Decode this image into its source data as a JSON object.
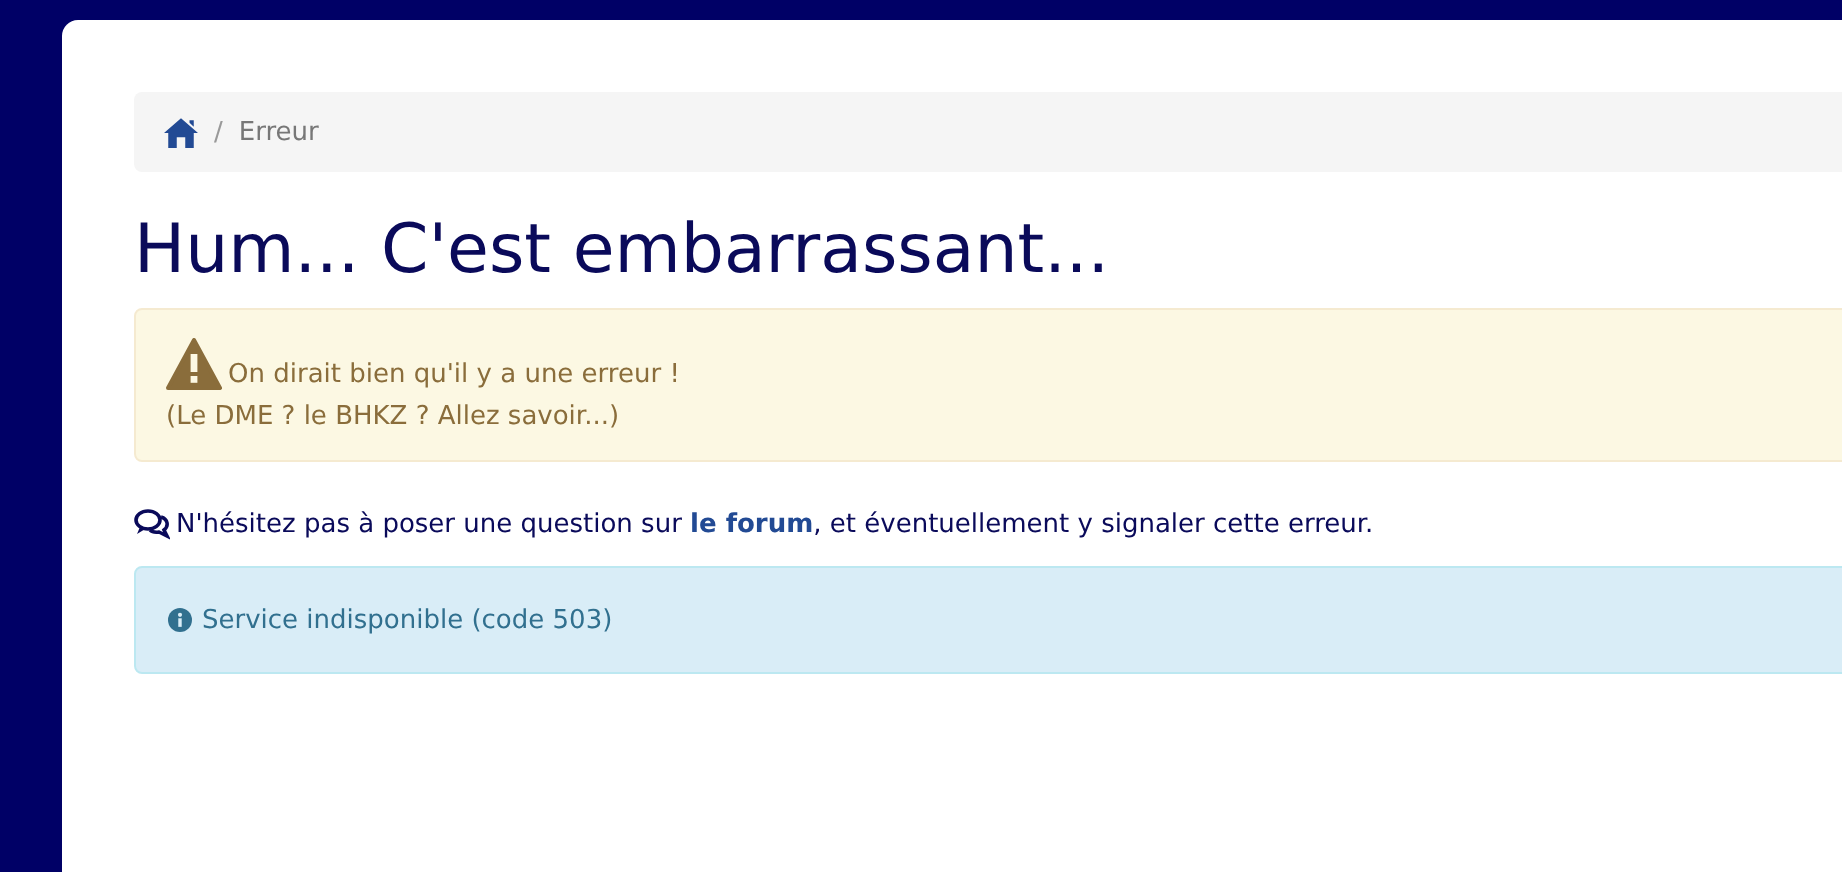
{
  "breadcrumb": {
    "items": [
      {
        "kind": "home"
      },
      {
        "kind": "text",
        "label": "Erreur"
      }
    ],
    "separator": "/"
  },
  "title": "Hum... C'est embarrassant...",
  "warning": {
    "line_1": "On dirait bien qu'il y a une erreur !",
    "line_2": "(Le DME ? le BHKZ ? Allez savoir...)"
  },
  "forum_note": {
    "before": "N'hésitez pas à poser une question sur ",
    "link": "le forum",
    "after": ", et éventuellement y signaler cette erreur."
  },
  "info": {
    "text": "Service indisponible (code 503)"
  }
}
